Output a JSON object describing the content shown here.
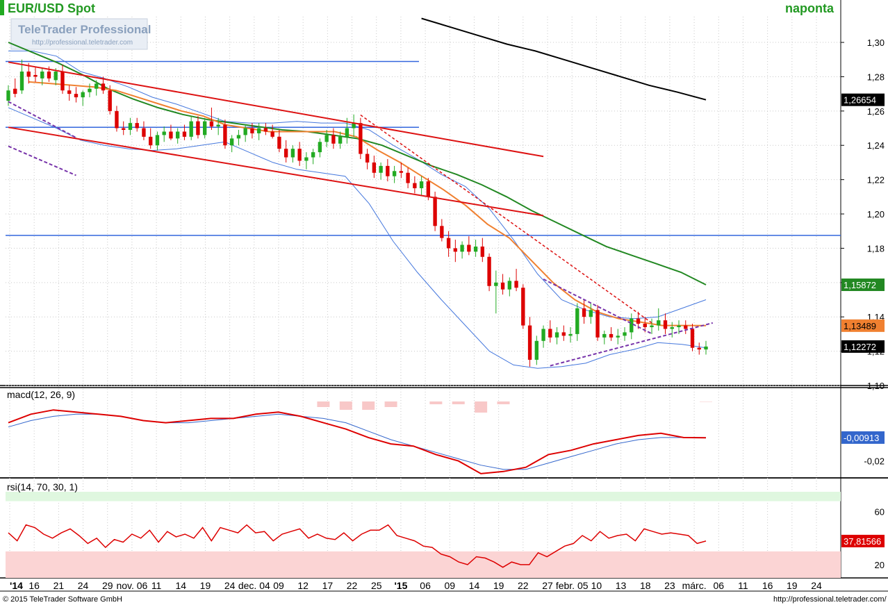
{
  "header": {
    "title": "EUR/USD Spot",
    "period": "naponta",
    "watermark_brand": "TeleTrader Professional",
    "watermark_url": "http://professional.teletrader.com"
  },
  "footer": {
    "copyright": "© 2015 TeleTrader Software GmbH",
    "url": "http://professional.teletrader.com/"
  },
  "colors": {
    "up": "#22aa22",
    "down": "#dd0000",
    "grid": "#c8c8c8",
    "sma_fast": "#f08030",
    "sma_mid": "#228822",
    "sma_slow": "#000000",
    "bollinger": "#4477dd",
    "macd_line": "#dd0000",
    "signal_line": "#3366cc",
    "histogram": "#f8c8c8",
    "rsi_line": "#dd0000",
    "rsi_over_zone": "#dff7df",
    "rsi_under_zone": "#fbd4d4"
  },
  "chart_data": {
    "type": "candlestick",
    "x_tick_labels": [
      "'14",
      "16",
      "21",
      "24",
      "29",
      "nov. 06",
      "11",
      "14",
      "19",
      "24",
      "dec. 04",
      "09",
      "12",
      "17",
      "22",
      "25",
      "'15",
      "06",
      "09",
      "14",
      "19",
      "22",
      "27",
      "febr. 05",
      "10",
      "13",
      "18",
      "23",
      "márc.",
      "06",
      "11",
      "16",
      "19",
      "24"
    ],
    "price_panel": {
      "y_ticks": [
        "1,30",
        "1,28",
        "1,26",
        "1,24",
        "1,22",
        "1,20",
        "1,18",
        "1,16",
        "1,14",
        "1,12",
        "1,10"
      ],
      "ylim": [
        1.1,
        1.315
      ],
      "value_badges": [
        {
          "label": "1,26654",
          "value": 1.26654,
          "color": "#000000"
        },
        {
          "label": "1,15872",
          "value": 1.15872,
          "color": "#228822"
        },
        {
          "label": "1,13489",
          "value": 1.13489,
          "color": "#f08030"
        },
        {
          "label": "1,12272",
          "value": 1.12272,
          "color": "#000000"
        }
      ],
      "candles": [
        [
          1.266,
          1.275,
          1.263,
          1.272
        ],
        [
          1.273,
          1.279,
          1.268,
          1.27
        ],
        [
          1.272,
          1.29,
          1.27,
          1.283
        ],
        [
          1.283,
          1.288,
          1.276,
          1.28
        ],
        [
          1.281,
          1.286,
          1.277,
          1.28
        ],
        [
          1.279,
          1.285,
          1.275,
          1.283
        ],
        [
          1.283,
          1.286,
          1.277,
          1.279
        ],
        [
          1.278,
          1.285,
          1.275,
          1.283
        ],
        [
          1.283,
          1.287,
          1.27,
          1.272
        ],
        [
          1.272,
          1.275,
          1.266,
          1.27
        ],
        [
          1.27,
          1.274,
          1.265,
          1.268
        ],
        [
          1.268,
          1.272,
          1.263,
          1.271
        ],
        [
          1.271,
          1.276,
          1.268,
          1.273
        ],
        [
          1.273,
          1.278,
          1.269,
          1.276
        ],
        [
          1.276,
          1.28,
          1.27,
          1.272
        ],
        [
          1.272,
          1.275,
          1.258,
          1.26
        ],
        [
          1.26,
          1.263,
          1.248,
          1.25
        ],
        [
          1.25,
          1.254,
          1.246,
          1.249
        ],
        [
          1.249,
          1.256,
          1.246,
          1.253
        ],
        [
          1.253,
          1.256,
          1.248,
          1.25
        ],
        [
          1.25,
          1.254,
          1.243,
          1.245
        ],
        [
          1.245,
          1.25,
          1.238,
          1.24
        ],
        [
          1.24,
          1.248,
          1.237,
          1.246
        ],
        [
          1.246,
          1.251,
          1.242,
          1.248
        ],
        [
          1.248,
          1.252,
          1.243,
          1.244
        ],
        [
          1.244,
          1.25,
          1.241,
          1.248
        ],
        [
          1.248,
          1.252,
          1.243,
          1.245
        ],
        [
          1.245,
          1.257,
          1.243,
          1.254
        ],
        [
          1.254,
          1.257,
          1.244,
          1.246
        ],
        [
          1.246,
          1.256,
          1.244,
          1.254
        ],
        [
          1.254,
          1.262,
          1.249,
          1.251
        ],
        [
          1.251,
          1.256,
          1.246,
          1.252
        ],
        [
          1.252,
          1.255,
          1.238,
          1.24
        ],
        [
          1.24,
          1.246,
          1.236,
          1.244
        ],
        [
          1.244,
          1.249,
          1.24,
          1.246
        ],
        [
          1.246,
          1.252,
          1.242,
          1.25
        ],
        [
          1.25,
          1.253,
          1.244,
          1.247
        ],
        [
          1.247,
          1.253,
          1.243,
          1.25
        ],
        [
          1.25,
          1.253,
          1.246,
          1.248
        ],
        [
          1.248,
          1.252,
          1.244,
          1.245
        ],
        [
          1.245,
          1.249,
          1.236,
          1.238
        ],
        [
          1.238,
          1.243,
          1.23,
          1.233
        ],
        [
          1.233,
          1.24,
          1.23,
          1.238
        ],
        [
          1.238,
          1.242,
          1.228,
          1.231
        ],
        [
          1.231,
          1.236,
          1.226,
          1.233
        ],
        [
          1.233,
          1.238,
          1.229,
          1.236
        ],
        [
          1.236,
          1.244,
          1.233,
          1.242
        ],
        [
          1.242,
          1.249,
          1.239,
          1.246
        ],
        [
          1.246,
          1.25,
          1.238,
          1.241
        ],
        [
          1.241,
          1.248,
          1.238,
          1.245
        ],
        [
          1.245,
          1.256,
          1.241,
          1.25
        ],
        [
          1.25,
          1.258,
          1.245,
          1.253
        ],
        [
          1.253,
          1.256,
          1.232,
          1.235
        ],
        [
          1.235,
          1.238,
          1.226,
          1.23
        ],
        [
          1.23,
          1.234,
          1.221,
          1.224
        ],
        [
          1.224,
          1.23,
          1.22,
          1.228
        ],
        [
          1.228,
          1.232,
          1.219,
          1.222
        ],
        [
          1.222,
          1.228,
          1.218,
          1.225
        ],
        [
          1.225,
          1.23,
          1.221,
          1.224
        ],
        [
          1.224,
          1.227,
          1.215,
          1.218
        ],
        [
          1.218,
          1.222,
          1.212,
          1.215
        ],
        [
          1.215,
          1.222,
          1.211,
          1.219
        ],
        [
          1.219,
          1.221,
          1.208,
          1.21
        ],
        [
          1.21,
          1.213,
          1.19,
          1.193
        ],
        [
          1.193,
          1.197,
          1.184,
          1.186
        ],
        [
          1.186,
          1.19,
          1.175,
          1.18
        ],
        [
          1.18,
          1.185,
          1.172,
          1.178
        ],
        [
          1.178,
          1.184,
          1.174,
          1.182
        ],
        [
          1.182,
          1.187,
          1.176,
          1.178
        ],
        [
          1.178,
          1.185,
          1.175,
          1.181
        ],
        [
          1.181,
          1.186,
          1.172,
          1.175
        ],
        [
          1.175,
          1.177,
          1.155,
          1.158
        ],
        [
          1.158,
          1.167,
          1.142,
          1.16
        ],
        [
          1.16,
          1.165,
          1.153,
          1.156
        ],
        [
          1.156,
          1.163,
          1.152,
          1.161
        ],
        [
          1.161,
          1.168,
          1.155,
          1.157
        ],
        [
          1.157,
          1.159,
          1.133,
          1.135
        ],
        [
          1.135,
          1.14,
          1.111,
          1.115
        ],
        [
          1.115,
          1.129,
          1.112,
          1.126
        ],
        [
          1.126,
          1.135,
          1.122,
          1.133
        ],
        [
          1.133,
          1.138,
          1.125,
          1.128
        ],
        [
          1.128,
          1.134,
          1.124,
          1.131
        ],
        [
          1.131,
          1.135,
          1.126,
          1.129
        ],
        [
          1.129,
          1.134,
          1.125,
          1.13
        ],
        [
          1.13,
          1.148,
          1.126,
          1.145
        ],
        [
          1.145,
          1.15,
          1.136,
          1.14
        ],
        [
          1.14,
          1.148,
          1.136,
          1.144
        ],
        [
          1.144,
          1.147,
          1.126,
          1.128
        ],
        [
          1.128,
          1.132,
          1.124,
          1.13
        ],
        [
          1.13,
          1.134,
          1.126,
          1.128
        ],
        [
          1.128,
          1.133,
          1.124,
          1.129
        ],
        [
          1.129,
          1.134,
          1.126,
          1.131
        ],
        [
          1.131,
          1.142,
          1.127,
          1.139
        ],
        [
          1.139,
          1.143,
          1.133,
          1.136
        ],
        [
          1.136,
          1.14,
          1.131,
          1.134
        ],
        [
          1.134,
          1.139,
          1.13,
          1.135
        ],
        [
          1.135,
          1.145,
          1.132,
          1.138
        ],
        [
          1.138,
          1.142,
          1.13,
          1.133
        ],
        [
          1.133,
          1.137,
          1.128,
          1.134
        ],
        [
          1.134,
          1.138,
          1.13,
          1.135
        ],
        [
          1.135,
          1.138,
          1.13,
          1.133
        ],
        [
          1.133,
          1.136,
          1.12,
          1.122
        ],
        [
          1.122,
          1.125,
          1.118,
          1.121
        ],
        [
          1.121,
          1.126,
          1.118,
          1.12272
        ]
      ],
      "series": {
        "sma_fast": [
          1.277,
          1.276,
          1.275,
          1.274,
          1.272,
          1.268,
          1.264,
          1.26,
          1.257,
          1.252,
          1.25,
          1.248,
          1.248,
          1.248,
          1.248,
          1.245,
          1.237,
          1.23,
          1.222,
          1.214,
          1.205,
          1.194,
          1.186,
          1.173,
          1.16,
          1.15,
          1.143,
          1.139,
          1.137,
          1.135,
          1.135,
          1.13489
        ],
        "sma_mid": [
          1.3,
          1.294,
          1.288,
          1.281,
          1.273,
          1.267,
          1.262,
          1.258,
          1.255,
          1.253,
          1.251,
          1.249,
          1.248,
          1.246,
          1.244,
          1.24,
          1.234,
          1.228,
          1.223,
          1.217,
          1.21,
          1.202,
          1.195,
          1.188,
          1.181,
          1.176,
          1.171,
          1.166,
          1.15872
        ],
        "sma_slow": [
          1.314,
          1.309,
          1.304,
          1.299,
          1.295,
          1.29,
          1.285,
          1.28,
          1.275,
          1.271,
          1.26654
        ],
        "boll_upper": [
          1.295,
          1.295,
          1.292,
          1.283,
          1.279,
          1.274,
          1.268,
          1.264,
          1.259,
          1.254,
          1.253,
          1.253,
          1.254,
          1.253,
          1.253,
          1.249,
          1.24,
          1.232,
          1.223,
          1.216,
          1.203,
          1.185,
          1.165,
          1.15,
          1.144,
          1.14,
          1.139,
          1.14,
          1.145,
          1.15
        ],
        "boll_lower": [
          1.262,
          1.256,
          1.25,
          1.243,
          1.24,
          1.238,
          1.237,
          1.238,
          1.24,
          1.242,
          1.236,
          1.23,
          1.226,
          1.224,
          1.222,
          1.206,
          1.184,
          1.166,
          1.15,
          1.135,
          1.12,
          1.112,
          1.11,
          1.111,
          1.113,
          1.118,
          1.121,
          1.125,
          1.124,
          1.122
        ]
      },
      "h_lines": [
        1.2889,
        1.2505,
        1.1875
      ]
    },
    "macd_panel": {
      "label": "macd(12, 26, 9)",
      "y_ticks": [
        "-0,02"
      ],
      "ylim": [
        -0.028,
        0.008
      ],
      "value_badge": "-0,00913",
      "macd": [
        -0.002,
        0.002,
        0.004,
        0.003,
        0.002,
        0.001,
        -0.001,
        -0.002,
        -0.001,
        0.0,
        0.0,
        0.002,
        0.003,
        0.001,
        -0.002,
        -0.005,
        -0.009,
        -0.012,
        -0.013,
        -0.017,
        -0.02,
        -0.026,
        -0.025,
        -0.023,
        -0.017,
        -0.015,
        -0.012,
        -0.01,
        -0.008,
        -0.007,
        -0.009,
        -0.00913
      ],
      "signal": [
        -0.004,
        -0.001,
        0.001,
        0.002,
        0.002,
        0.001,
        -0.001,
        -0.002,
        -0.002,
        -0.001,
        0.0,
        0.001,
        0.002,
        0.001,
        0.0,
        -0.002,
        -0.006,
        -0.01,
        -0.013,
        -0.016,
        -0.019,
        -0.022,
        -0.024,
        -0.024,
        -0.021,
        -0.018,
        -0.015,
        -0.012,
        -0.01,
        -0.009,
        -0.009,
        -0.009
      ]
    },
    "rsi_panel": {
      "label": "rsi(14, 70, 30, 1)",
      "y_ticks": [
        "60",
        "40",
        "20"
      ],
      "ylim": [
        10,
        75
      ],
      "overbought": 70,
      "oversold": 30,
      "value_badge": "37,81566",
      "values": [
        44,
        38,
        50,
        48,
        43,
        40,
        44,
        47,
        42,
        36,
        40,
        33,
        39,
        37,
        43,
        40,
        46,
        37,
        45,
        41,
        43,
        40,
        48,
        38,
        48,
        46,
        44,
        50,
        44,
        45,
        38,
        43,
        45,
        47,
        40,
        43,
        40,
        39,
        44,
        38,
        43,
        46,
        46,
        50,
        42,
        40,
        38,
        34,
        33,
        28,
        26,
        22,
        20,
        26,
        25,
        22,
        18,
        22,
        20,
        20,
        29,
        26,
        30,
        34,
        36,
        42,
        38,
        45,
        40,
        42,
        43,
        38,
        47,
        45,
        43,
        44,
        43,
        42,
        36,
        37.81566
      ]
    }
  }
}
